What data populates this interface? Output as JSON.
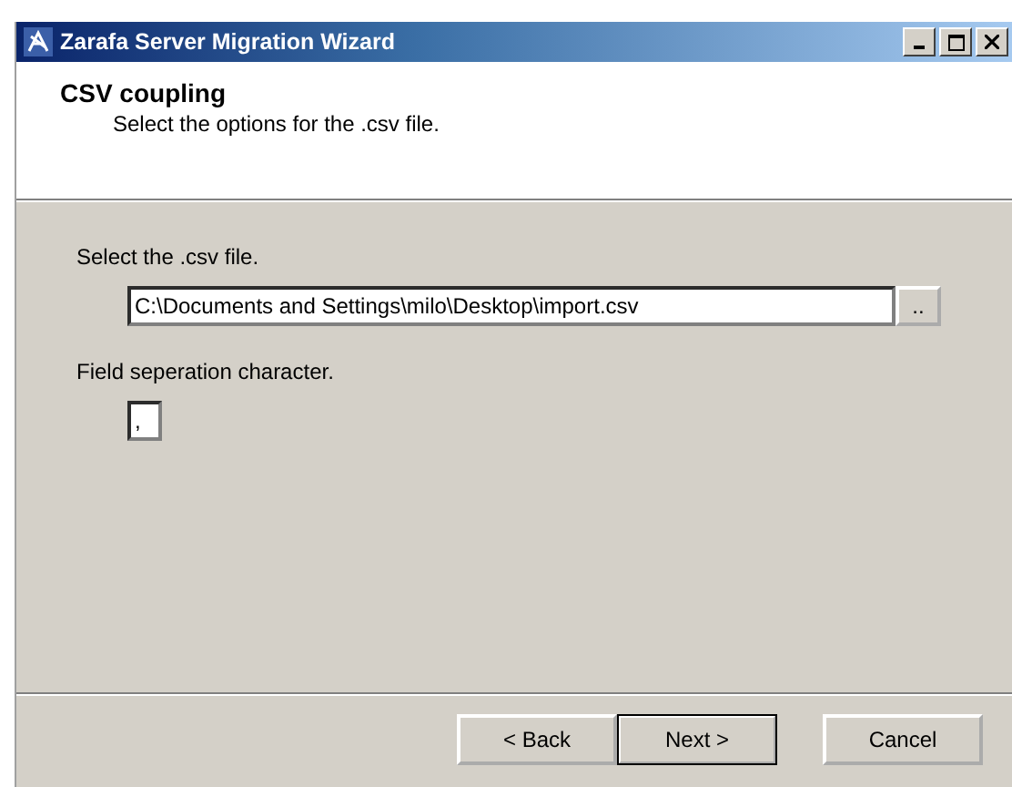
{
  "window": {
    "title": "Zarafa Server Migration Wizard"
  },
  "header": {
    "title": "CSV coupling",
    "subtitle": "Select the options for the .csv file."
  },
  "fields": [
    {
      "label": "Select the .csv file.",
      "value": "C:\\Documents and Settings\\milo\\Desktop\\import.csv",
      "browse": ".."
    },
    {
      "label": "Field seperation character.",
      "value": ","
    }
  ],
  "buttons": [
    {
      "label": "< Back",
      "default": false
    },
    {
      "label": "Next >",
      "default": true
    },
    {
      "label": "Cancel",
      "default": false
    }
  ]
}
